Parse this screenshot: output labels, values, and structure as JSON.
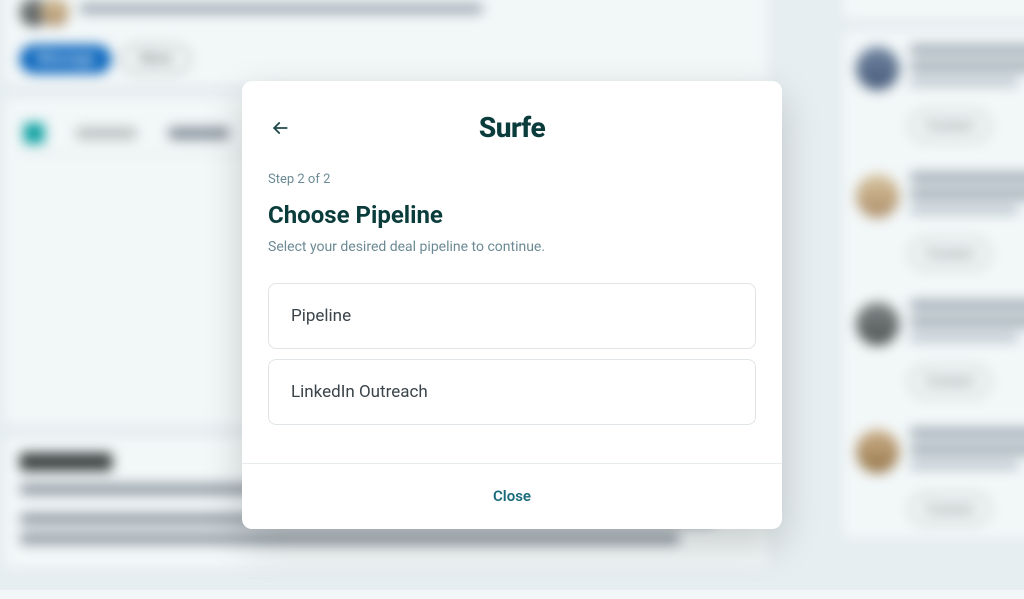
{
  "modal": {
    "logo_text": "Surfe",
    "step_label": "Step 2 of 2",
    "title": "Choose Pipeline",
    "subtitle": "Select your desired deal pipeline to continue.",
    "options": [
      {
        "label": "Pipeline"
      },
      {
        "label": "LinkedIn Outreach"
      }
    ],
    "close_label": "Close"
  },
  "background": {
    "follow_pill": "+ Follow",
    "connect_pill": "Connect",
    "message_btn": "Message",
    "more_btn": "More",
    "about_heading": "About"
  }
}
